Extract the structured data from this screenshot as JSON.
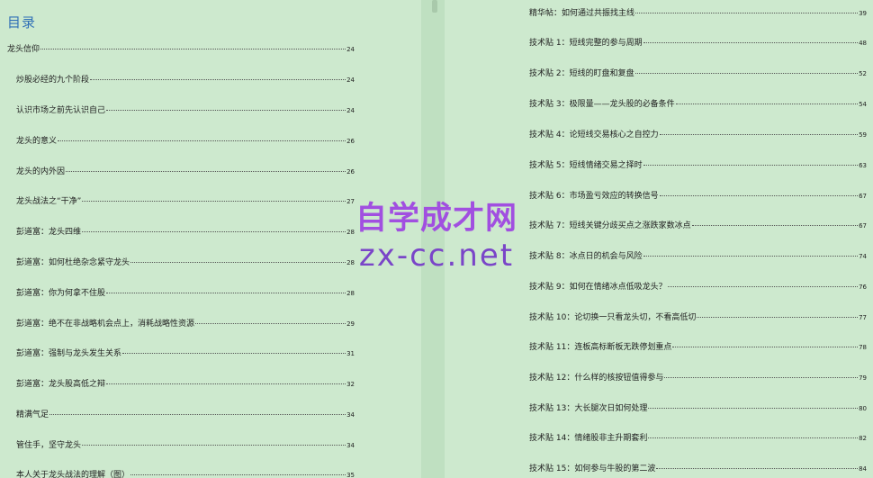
{
  "toc_heading": "目录",
  "left_entries": [
    {
      "title": "龙头信仰",
      "page": "24"
    },
    {
      "title": "炒股必经的九个阶段",
      "page": "24"
    },
    {
      "title": "认识市场之前先认识自己",
      "page": "24"
    },
    {
      "title": "龙头的意义",
      "page": "26"
    },
    {
      "title": "龙头的内外因",
      "page": "26"
    },
    {
      "title": "龙头战法之“干净”",
      "page": "27"
    },
    {
      "title": "彭道富：龙头四维",
      "page": "28"
    },
    {
      "title": "彭道富：如何杜绝杂念紧守龙头",
      "page": "28"
    },
    {
      "title": "彭道富：你为何拿不住股",
      "page": "28"
    },
    {
      "title": "彭道富：绝不在非战略机会点上，消耗战略性资源",
      "page": "29"
    },
    {
      "title": "彭道富：强制与龙头发生关系",
      "page": "31"
    },
    {
      "title": "彭道富：龙头股高低之辩",
      "page": "32"
    },
    {
      "title": "精满气足",
      "page": "34"
    },
    {
      "title": "管住手，坚守龙头",
      "page": "34"
    },
    {
      "title": "本人关于龙头战法的理解（图）",
      "page": "35"
    }
  ],
  "right_entries": [
    {
      "title": "精华帖：如何通过共振找主线",
      "page": "39"
    },
    {
      "title": "技术贴 1：短线完整的参与周期",
      "page": "48"
    },
    {
      "title": "技术贴 2：短线的盯盘和复盘",
      "page": "52"
    },
    {
      "title": "技术贴 3：极限量——龙头股的必备条件",
      "page": "54"
    },
    {
      "title": "技术贴 4：论短线交易核心之自控力",
      "page": "59"
    },
    {
      "title": "技术贴 5：短线情绪交易之择时",
      "page": "63"
    },
    {
      "title": "技术贴 6：市场盈亏效应的转换信号",
      "page": "67"
    },
    {
      "title": "技术贴 7：短线关键分歧买点之涨跌家数冰点",
      "page": "67"
    },
    {
      "title": "技术贴 8：冰点日的机会与风险",
      "page": "74"
    },
    {
      "title": "技术贴 9：如何在情绪冰点低吸龙头？",
      "page": "76"
    },
    {
      "title": "技术贴 10：论切换一只看龙头切，不看高低切",
      "page": "77"
    },
    {
      "title": "技术贴 11：连板高标断板无跌停划重点",
      "page": "78"
    },
    {
      "title": "技术贴 12：什么样的核按钮值得参与",
      "page": "79"
    },
    {
      "title": "技术贴 13：大长腿次日如何处理",
      "page": "80"
    },
    {
      "title": "技术贴 14：情绪股非主升期套利",
      "page": "82"
    },
    {
      "title": "技术贴 15：如何参与牛股的第二波",
      "page": "84"
    }
  ],
  "watermark": {
    "line1": "自学成才网",
    "line2": "zx-cc.net"
  }
}
